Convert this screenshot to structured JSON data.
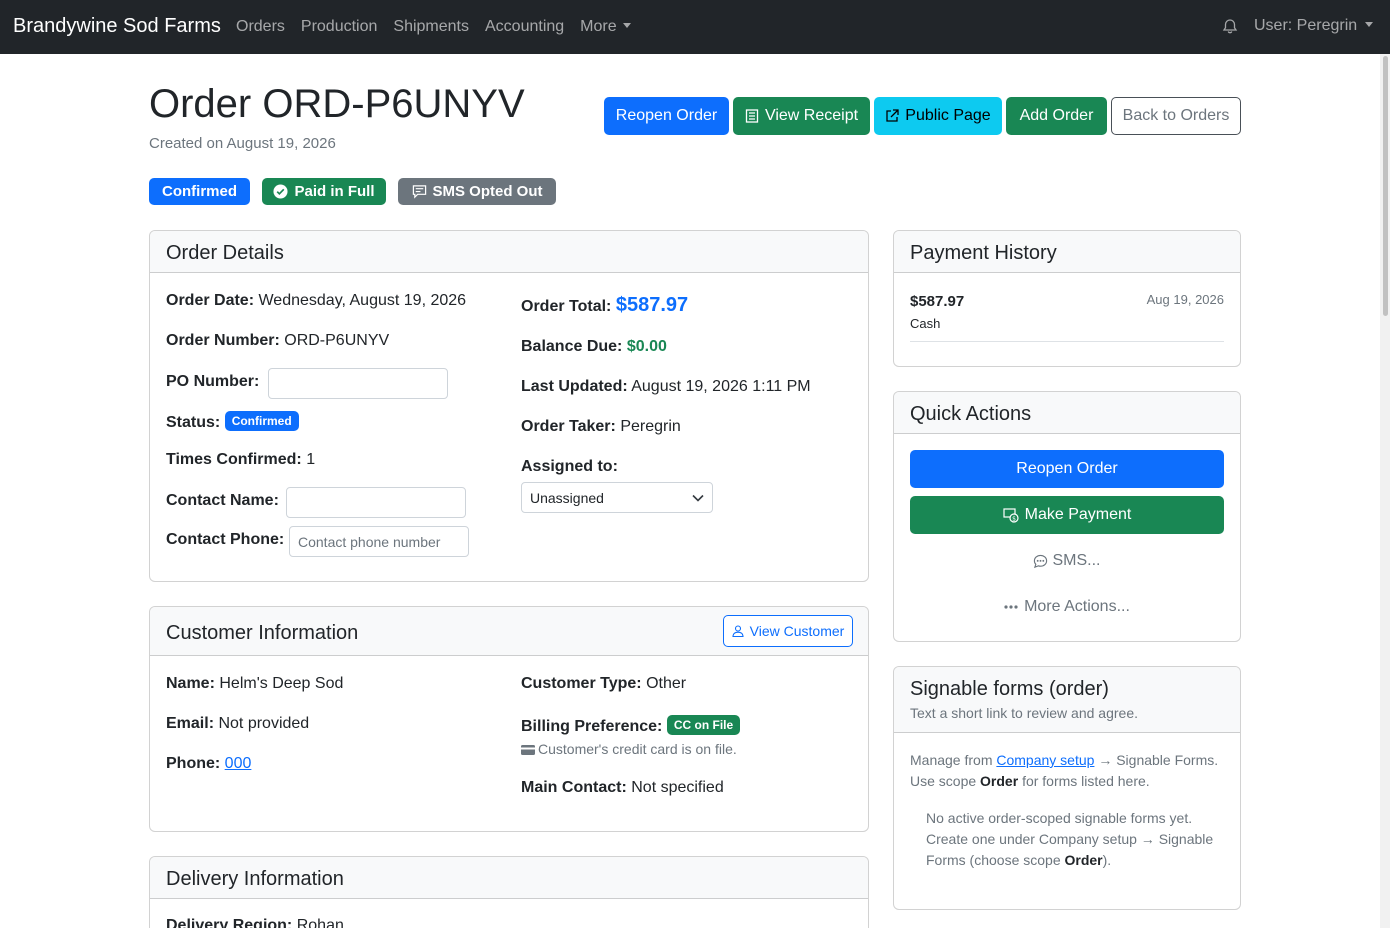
{
  "nav": {
    "brand": "Brandywine Sod Farms",
    "links": [
      "Orders",
      "Production",
      "Shipments",
      "Accounting"
    ],
    "more": "More",
    "user": "User: Peregrin"
  },
  "header": {
    "title": "Order ORD-P6UNYV",
    "created": "Created on August 19, 2026",
    "buttons": {
      "reopen": "Reopen Order",
      "receipt": "View Receipt",
      "public": "Public Page",
      "add": "Add Order",
      "back": "Back to Orders"
    },
    "badges": {
      "confirmed": "Confirmed",
      "paid": "Paid in Full",
      "sms": "SMS Opted Out"
    }
  },
  "order_details": {
    "title": "Order Details",
    "order_date_label": "Order Date:",
    "order_date": "Wednesday, August 19, 2026",
    "order_number_label": "Order Number:",
    "order_number": "ORD-P6UNYV",
    "po_label": "PO Number:",
    "po_value": "",
    "status_label": "Status:",
    "status": "Confirmed",
    "times_confirmed_label": "Times Confirmed:",
    "times_confirmed": "1",
    "contact_name_label": "Contact Name:",
    "contact_name": "",
    "contact_phone_label": "Contact Phone:",
    "contact_phone_placeholder": "Contact phone number",
    "order_total_label": "Order Total:",
    "order_total": "$587.97",
    "balance_due_label": "Balance Due:",
    "balance_due": "$0.00",
    "last_updated_label": "Last Updated:",
    "last_updated": "August 19, 2026 1:11 PM",
    "order_taker_label": "Order Taker:",
    "order_taker": "Peregrin",
    "assigned_label": "Assigned to:",
    "assigned": "Unassigned"
  },
  "customer": {
    "title": "Customer Information",
    "view_button": "View Customer",
    "name_label": "Name:",
    "name": "Helm's Deep Sod",
    "email_label": "Email:",
    "email": "Not provided",
    "phone_label": "Phone:",
    "phone": "000",
    "type_label": "Customer Type:",
    "type": "Other",
    "billing_label": "Billing Preference:",
    "billing_badge": "CC on File",
    "billing_note": "Customer's credit card is on file.",
    "main_contact_label": "Main Contact:",
    "main_contact": "Not specified"
  },
  "delivery": {
    "title": "Delivery Information",
    "region_label": "Delivery Region:",
    "region": "Rohan"
  },
  "payment_history": {
    "title": "Payment History",
    "amount": "$587.97",
    "date": "Aug 19, 2026",
    "method": "Cash"
  },
  "quick_actions": {
    "title": "Quick Actions",
    "reopen": "Reopen Order",
    "payment": "Make Payment",
    "sms": "SMS...",
    "more": "More Actions..."
  },
  "signable": {
    "title": "Signable forms (order)",
    "subtitle": "Text a short link to review and agree.",
    "manage_pre": "Manage from",
    "manage_link": "Company setup",
    "manage_post": "→ Signable Forms.",
    "scope_pre": "Use scope",
    "scope_word": "Order",
    "scope_post": "for forms listed here.",
    "empty_line1": "No active order-scoped signable forms yet.",
    "empty_line2": "Create one under Company setup → Signable",
    "empty_line3_pre": "Forms (choose scope",
    "empty_line3_word": "Order",
    "empty_line3_post": ")."
  },
  "colors": {
    "primary": "#0d6efd",
    "success": "#198754",
    "info": "#0dcaf0",
    "secondary": "#6c757d",
    "navbar": "#212529"
  }
}
